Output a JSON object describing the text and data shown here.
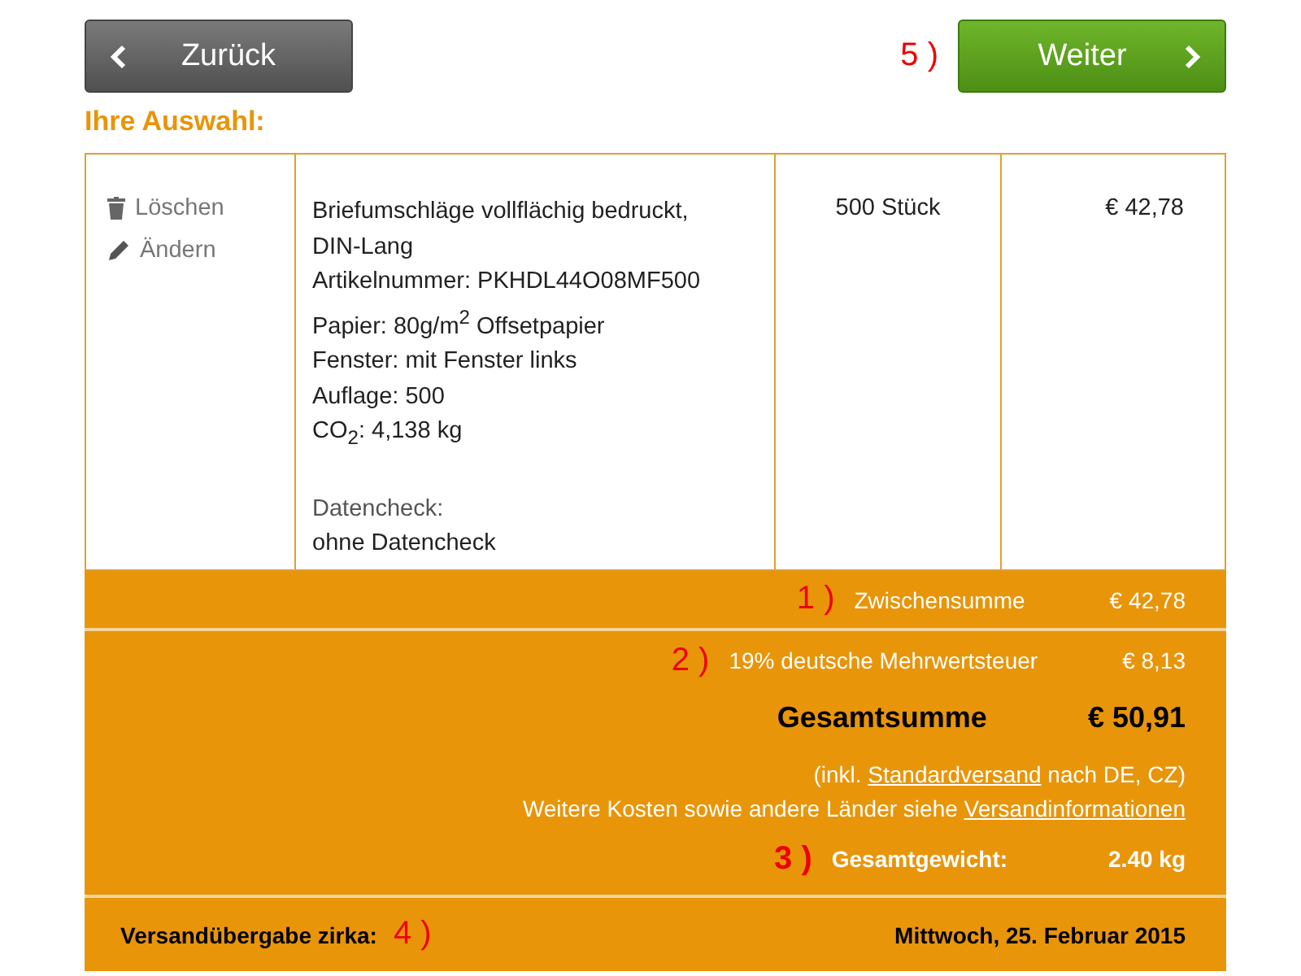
{
  "nav": {
    "back_button": "Zurück",
    "next_marker": "5 )",
    "next_button": "Weiter"
  },
  "section_title": "Ihre Auswahl:",
  "item": {
    "actions": [
      {
        "kind": "delete",
        "label": "Löschen"
      },
      {
        "kind": "edit",
        "label": "Ändern"
      }
    ],
    "description": [
      "Briefumschläge vollflächig bedruckt,",
      "DIN-Lang",
      "Artikelnummer: PKHDL44O08MF500",
      "Papier: 80g/m$^{2}$ Offsetpapier",
      "Fenster: mit Fenster links",
      "Auflage: 500",
      "CO$_{2}$: 4,138 kg"
    ],
    "check_label": "Datencheck:",
    "check_value": "ohne Datencheck",
    "quantity": "500 Stück",
    "price": "€ 42,78"
  },
  "subtotal": {
    "marker": "1 )",
    "label": "Zwischensumme",
    "value": "€ 42,78"
  },
  "tax": {
    "marker": "2 )",
    "label": "19% deutsche Mehrwertsteuer",
    "value": "€ 8,13"
  },
  "total": {
    "label": "Gesamtsumme",
    "value": "€ 50,91"
  },
  "notes": [
    [
      {
        "text": "(inkl. "
      },
      {
        "text": "Standardversand",
        "link": true
      },
      {
        "text": " nach DE, CZ)"
      }
    ],
    [
      {
        "text": "Weitere Kosten sowie andere Länder siehe "
      },
      {
        "text": "Versandinformationen",
        "link": true
      }
    ]
  ],
  "weight": {
    "marker": "3 )",
    "label": "Gesamtgewicht:",
    "value": "2.40 kg"
  },
  "delivery": {
    "label": "Versandübergabe zirka:",
    "marker": "4 )",
    "value": "Mittwoch, 25. Februar 2015"
  }
}
